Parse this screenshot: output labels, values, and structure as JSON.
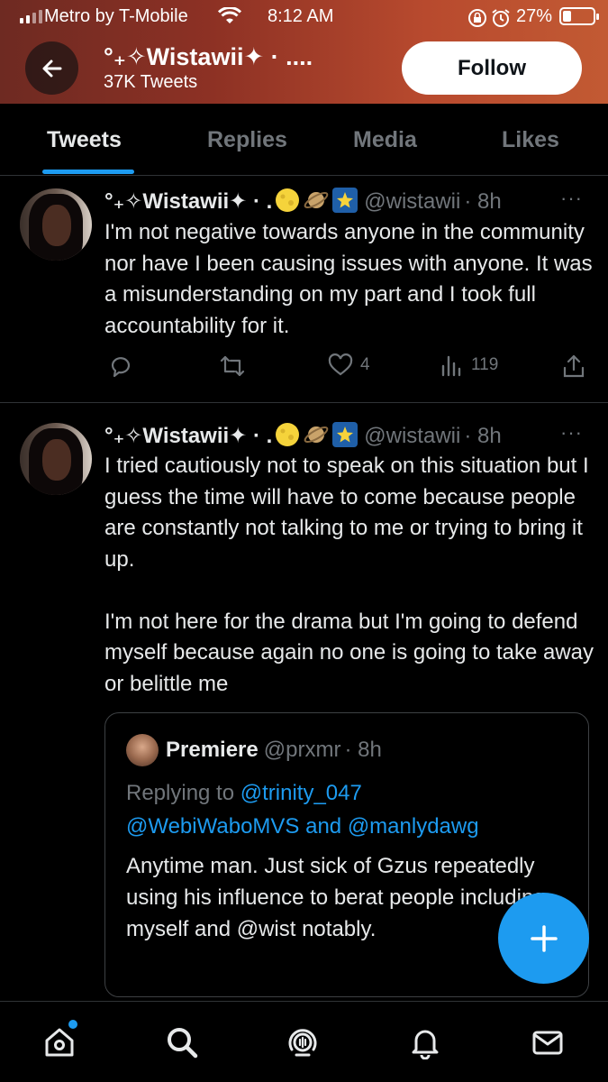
{
  "status_bar": {
    "carrier": "Metro by T-Mobile",
    "time": "8:12 AM",
    "battery": "27%",
    "battery_level": 0.27
  },
  "header": {
    "profile_name": "°₊✧Wistawii✦ · ....",
    "tweet_count": "37K Tweets",
    "follow_label": "Follow"
  },
  "tabs": [
    {
      "label": "Tweets",
      "active": true
    },
    {
      "label": "Replies",
      "active": false
    },
    {
      "label": "Media",
      "active": false
    },
    {
      "label": "Likes",
      "active": false
    }
  ],
  "tweets": [
    {
      "name": "°₊✧Wistawii✦ · .",
      "handle": "@wistawii",
      "time": "· 8h",
      "more": "···",
      "body": "I'm not negative towards anyone in the community nor have I been causing issues with anyone. It was a misunderstanding on my part and I took full accountability for it.",
      "likes": "4",
      "views": "119"
    },
    {
      "name": "°₊✧Wistawii✦ · .",
      "handle": "@wistawii",
      "time": "· 8h",
      "more": "···",
      "body": "I tried cautiously not to speak on this situation but I guess the time will have to come because people are constantly not talking to me or trying to bring it up.\n\nI'm not here for the drama but I'm going to defend myself because again no one is going to take away or belittle me",
      "quote": {
        "name": "Premiere",
        "handle": "@prxmr",
        "time": "· 8h",
        "replying_prefix": "Replying to ",
        "reply_mention_1": "@trinity_047",
        "reply_mention_2": "@WebiWaboMVS",
        "reply_and": " and ",
        "reply_mention_3": "@manlydawg",
        "body": "Anytime man. Just sick of Gzus repeatedly using his influence to berat people including myself and @wist notably."
      }
    }
  ],
  "colors": {
    "accent": "#1d9bf0",
    "muted": "#71767b",
    "text": "#e7e9ea",
    "background": "#000000"
  },
  "icons": [
    "back-arrow-icon",
    "reply-icon",
    "retweet-icon",
    "like-icon",
    "views-icon",
    "share-icon",
    "compose-plus-icon",
    "home-icon",
    "search-icon",
    "spaces-icon",
    "notifications-icon",
    "messages-icon"
  ]
}
